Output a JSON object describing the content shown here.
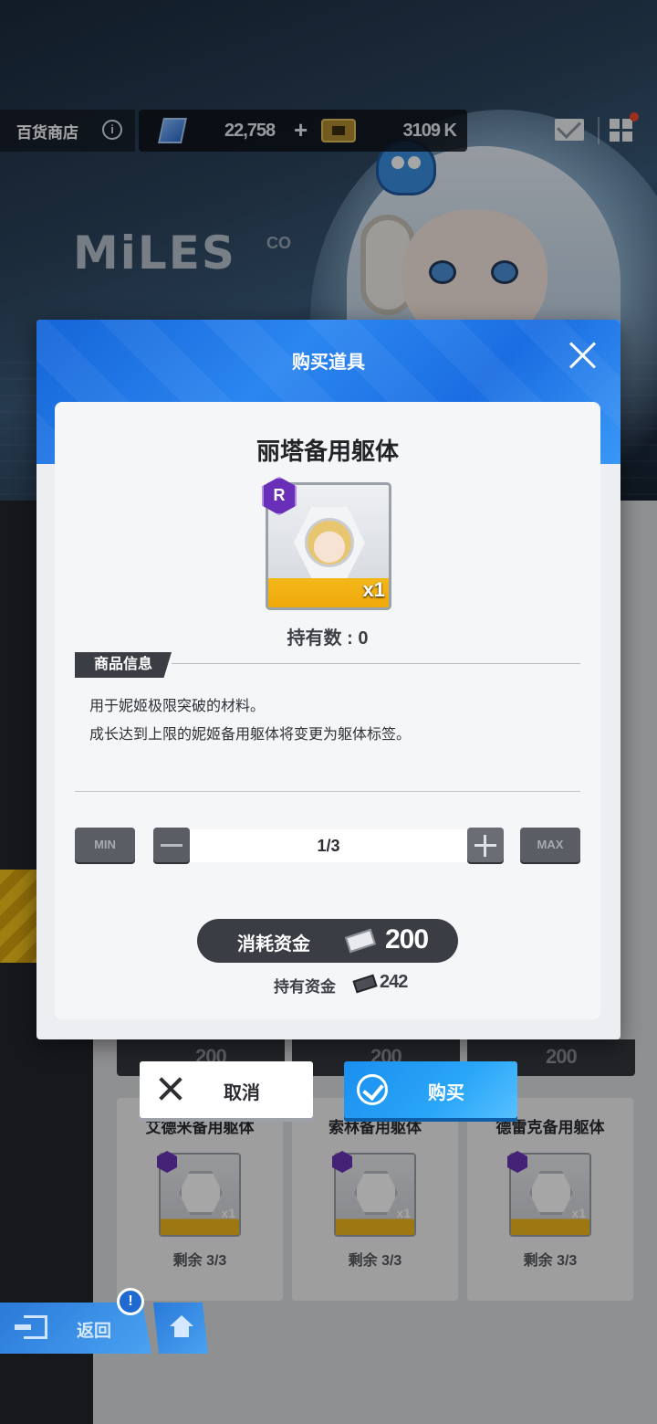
{
  "topbar": {
    "store_title": "百货商店",
    "info_icon": "i",
    "gems": "22,758",
    "gem_plus": "+",
    "tickets": "3109 K"
  },
  "background": {
    "logo_text": "MiLES",
    "logo_sub": "CO"
  },
  "modal": {
    "title": "购买道具",
    "item_name": "丽塔备用躯体",
    "rarity": "R",
    "item_qty": "x1",
    "owned": "持有数 : 0",
    "info_tab": "商品信息",
    "description": [
      "用于妮姬极限突破的材料。",
      "成长达到上限的妮姬备用躯体将变更为躯体标签。"
    ],
    "qty": {
      "min_label": "MIN",
      "max_label": "MAX",
      "value": "1/3"
    },
    "cost_label": "消耗资金",
    "cost_value": "200",
    "hold_label": "持有资金",
    "hold_value": "242"
  },
  "actions": {
    "cancel_label": "取消",
    "buy_label": "购买"
  },
  "shop": {
    "prices": [
      "200",
      "200",
      "200"
    ],
    "items": [
      {
        "name": "艾德米备用躯体",
        "qty": "x1",
        "remain": "剩余 3/3"
      },
      {
        "name": "索林备用躯体",
        "qty": "x1",
        "remain": "剩余 3/3"
      },
      {
        "name": "德雷克备用躯体",
        "qty": "x1",
        "remain": "剩余 3/3"
      }
    ]
  },
  "nav": {
    "back_label": "返回",
    "alert": "!"
  },
  "colors": {
    "accent_blue": "#2b86f0",
    "rarity_purple": "#6a2fb8",
    "dark_panel": "#3a3d43"
  }
}
